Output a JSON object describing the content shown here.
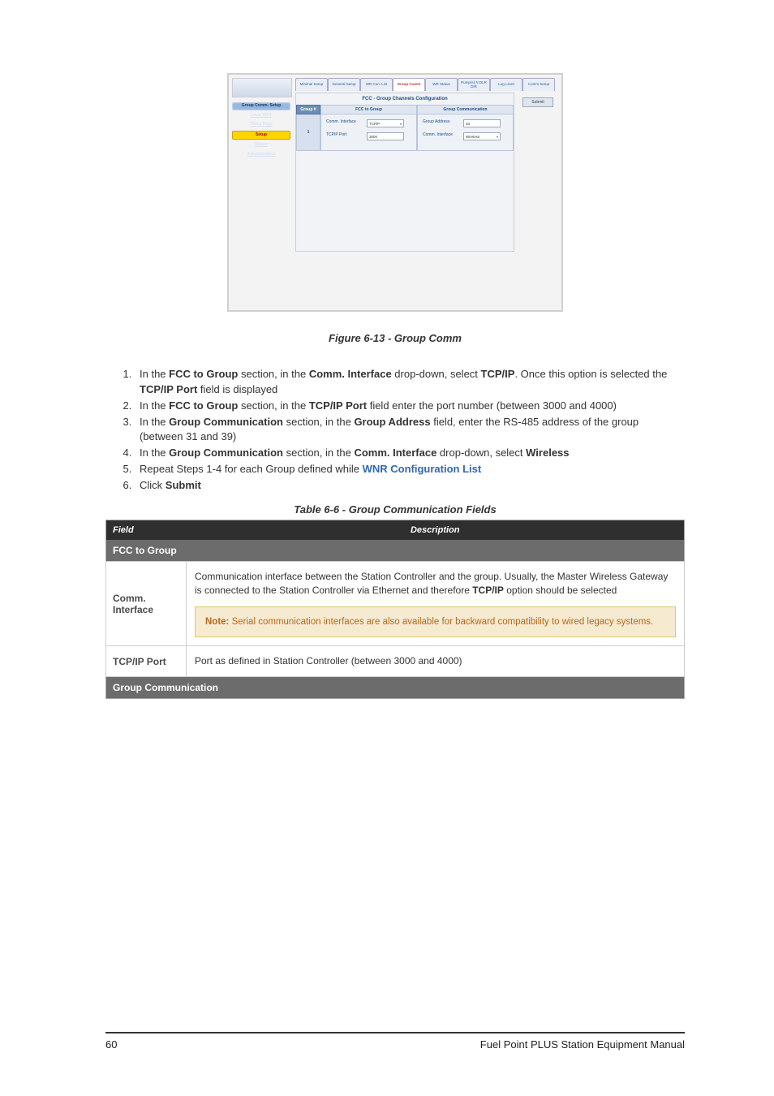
{
  "figure": {
    "caption": "Figure 6-13 - Group Comm",
    "tabs": [
      "Minimal Setup",
      "General Setup",
      "WR Con. List",
      "Group Comm",
      "WR Status",
      "Pump(s) N DLR DIR",
      "Log Level",
      "Comm Setup"
    ],
    "active_tab_index": 3,
    "submit": "Submit",
    "title": "FCC - Group Channels Configuration",
    "side_nav": {
      "group_comm_setup": "Group Comm. Setup",
      "local_wgt": "Local WGT",
      "home_page": "Home Page",
      "setup": "Setup",
      "status": "Status",
      "admin": "Administration"
    },
    "group_col": "Group #",
    "group_num": "1",
    "fcc_section": "FCC to Group",
    "comm_section": "Group Communication",
    "fields": {
      "comm_if_label": "Comm. Interface",
      "comm_if_left": "TCPIP",
      "tcp_port_label": "TCPIP Port",
      "tcp_port_value": "3000",
      "group_addr_label": "Group Address",
      "group_addr_value": "33",
      "comm_if_right_label": "Comm. Interface",
      "comm_if_right": "Wireless"
    }
  },
  "steps": {
    "s1a": "In the ",
    "s1b": "FCC to Group",
    "s1c": " section, in the ",
    "s1d": "Comm. Interface",
    "s1e": " drop-down, select ",
    "s1f": "TCP/IP",
    "s1g": ". Once this option is selected the ",
    "s1h": "TCP/IP Port",
    "s1i": " field is displayed",
    "s2a": "In the ",
    "s2b": "FCC to Group",
    "s2c": " section, in the ",
    "s2d": "TCP/IP Port",
    "s2e": " field enter the port number (between 3000 and 4000)",
    "s3a": "In the ",
    "s3b": "Group Communication",
    "s3c": " section, in the ",
    "s3d": "Group Address",
    "s3e": " field, enter the RS-485 address of the group (between 31 and 39)",
    "s4a": "In the ",
    "s4b": "Group Communication",
    "s4c": " section, in the ",
    "s4d": "Comm. Interface",
    "s4e": " drop-down, select ",
    "s4f": "Wireless",
    "s5a": "Repeat Steps 1-4 for each Group defined while ",
    "s5b": "WNR Configuration List",
    "s6a": "Click ",
    "s6b": "Submit"
  },
  "table": {
    "caption": "Table 6-6 - Group Communication Fields",
    "head_field": "Field",
    "head_desc": "Description",
    "sec1": "FCC to Group",
    "r1_field": "Comm. Interface",
    "r1_desc_a": "Communication interface between the Station Controller and the group. Usually, the Master Wireless Gateway is connected to the Station Controller via Ethernet and therefore ",
    "r1_desc_b": "TCP/IP",
    "r1_desc_c": " option should be selected",
    "r1_note_label": "Note: ",
    "r1_note_text": "Serial communication interfaces are also available for backward compatibility to wired legacy systems.",
    "r2_field": "TCP/IP Port",
    "r2_desc": "Port as defined in Station Controller (between 3000 and 4000)",
    "sec2": "Group Communication"
  },
  "footer": {
    "page": "60",
    "doc": "Fuel Point PLUS Station Equipment Manual"
  }
}
